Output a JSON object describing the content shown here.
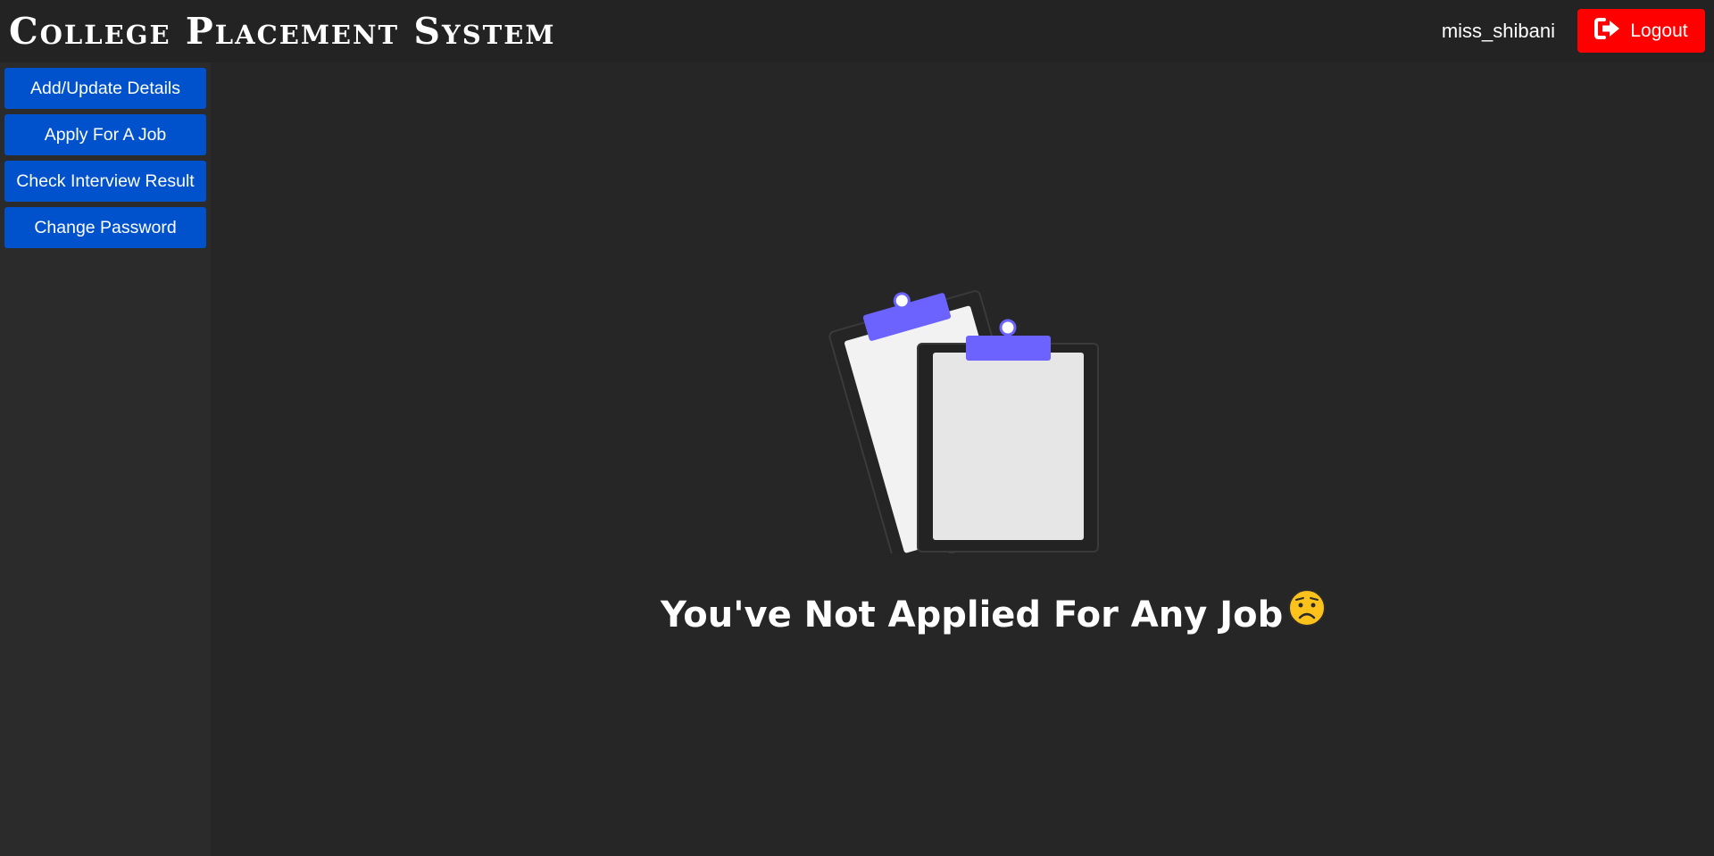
{
  "header": {
    "title": "College Placement System",
    "username": "miss_shibani",
    "logout_label": "Logout",
    "logout_icon": "sign-out-icon",
    "logout_color": "#ff0000"
  },
  "sidebar": {
    "items": [
      {
        "label": "Add/Update Details"
      },
      {
        "label": "Apply For A Job"
      },
      {
        "label": "Check Interview Result"
      },
      {
        "label": "Change Password"
      }
    ],
    "button_color": "#0052cc"
  },
  "main": {
    "illustration_icon": "clipboards-icon",
    "empty_message": "You've Not Applied For Any Job",
    "emoji_icon": "worried-face-icon",
    "accent_color": "#6c63ff"
  },
  "colors": {
    "background": "#262626",
    "header": "#232323",
    "sidebar": "#2b2b2b"
  }
}
